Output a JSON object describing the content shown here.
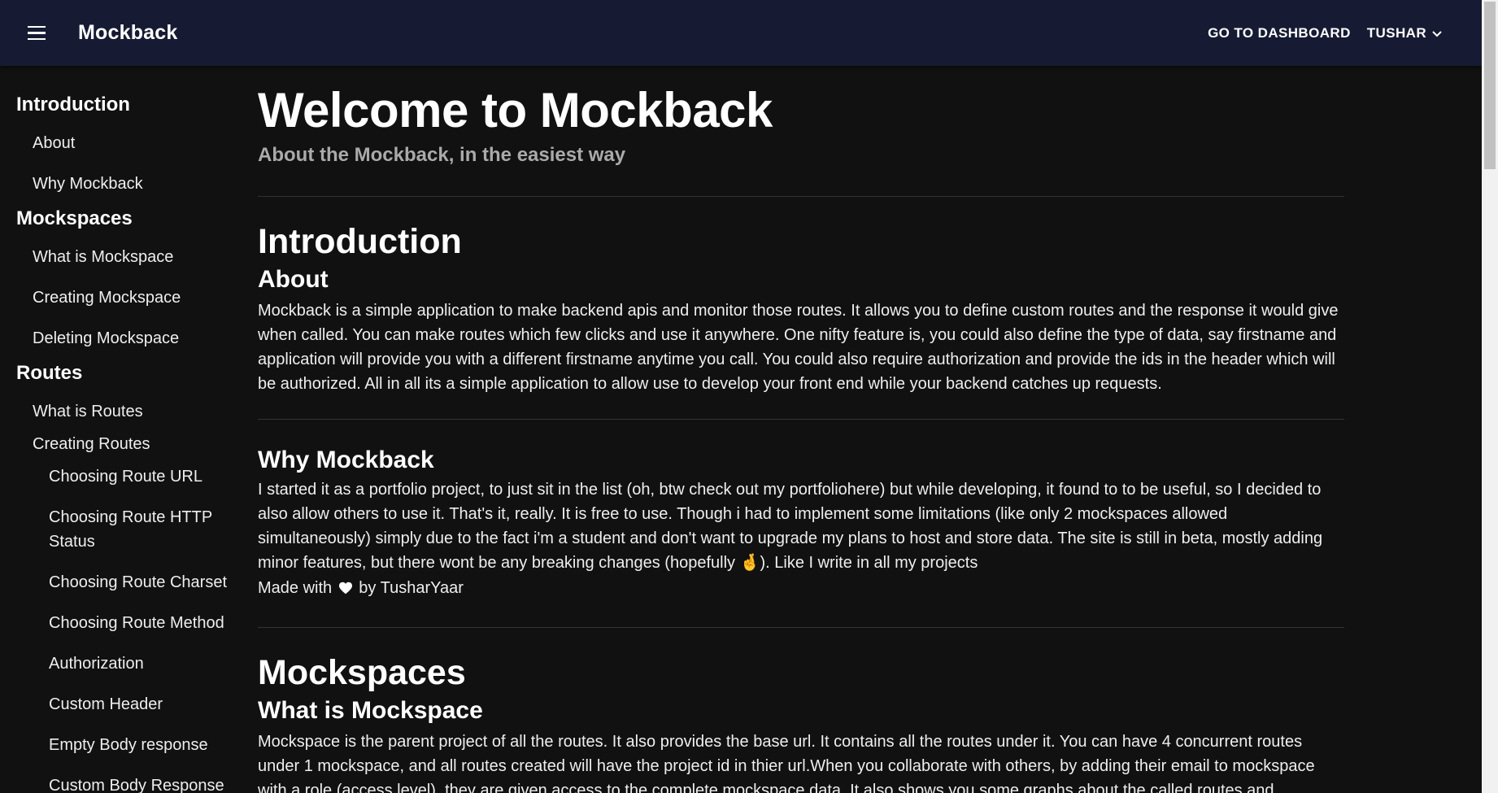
{
  "app": {
    "brand": "Mockback"
  },
  "header": {
    "dashboard_label": "GO TO DASHBOARD",
    "user_label": "TUSHAR"
  },
  "sidebar": {
    "sections": [
      {
        "title": "Introduction",
        "items": [
          "About",
          "Why Mockback"
        ]
      },
      {
        "title": "Mockspaces",
        "items": [
          "What is Mockspace",
          "Creating Mockspace",
          "Deleting Mockspace"
        ]
      },
      {
        "title": "Routes",
        "items": [
          "What is Routes",
          "Creating Routes"
        ]
      }
    ],
    "route_subitems": [
      "Choosing Route URL",
      "Choosing Route HTTP Status",
      "Choosing Route Charset",
      "Choosing Route Method",
      "Authorization",
      "Custom Header",
      "Empty Body response",
      "Custom Body Response"
    ]
  },
  "main": {
    "title": "Welcome to Mockback",
    "subtitle": "About the Mockback, in the easiest way",
    "intro_heading": "Introduction",
    "about_heading": "About",
    "about_text": "Mockback is a simple application to make backend apis and monitor those routes. It allows you to define custom routes and the response it would give when called. You can make routes which few clicks and use it anywhere. One nifty feature is, you could also define the type of data, say firstname and application will provide you with a different firstname anytime you call. You could also require authorization and provide the ids in the header which will be authorized. All in all its a simple application to allow use to develop your front end while your backend catches up requests.",
    "why_heading": "Why Mockback",
    "why_text": "I started it as a portfolio project, to just sit in the list (oh, btw check out my portfoliohere) but while developing, it found to to be useful, so I decided to also allow others to use it. That's it, really. It is free to use. Though i had to implement some limitations (like only 2 mockspaces allowed simultaneously) simply due to the fact i'm a student and don't want to upgrade my plans to host and store data. The site is still in beta, mostly adding minor features, but there wont be any breaking changes (hopefully 🤞). Like I write in all my projects",
    "made_with_prefix": "Made with",
    "made_with_suffix": "by TusharYaar",
    "mockspaces_heading": "Mockspaces",
    "what_mockspace_heading": "What is Mockspace",
    "what_mockspace_text": "Mockspace is the parent project of all the routes. It also provides the base url. It contains all the routes under it. You can have 4 concurrent routes under 1 mockspace, and all routes created will have the project id in thier url.When you collaborate with others, by adding their email to mockspace with a role (access level), they are given access to the complete mockspace data. It also shows you some graphs about the called routes and"
  }
}
